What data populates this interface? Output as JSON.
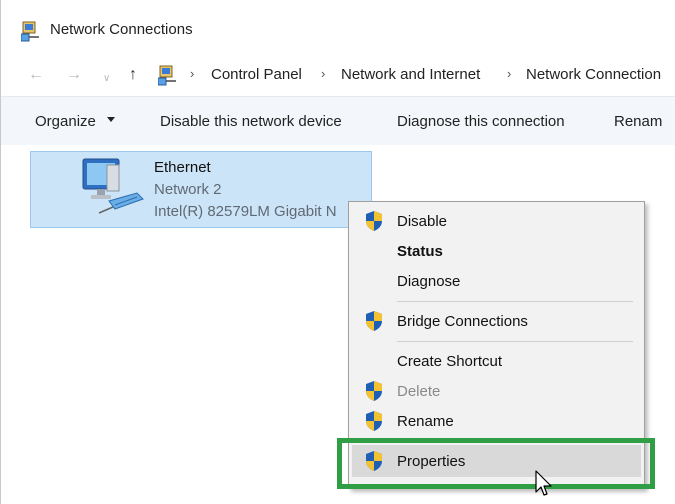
{
  "window": {
    "title": "Network Connections"
  },
  "address": {
    "breadcrumbs": [
      "Control Panel",
      "Network and Internet",
      "Network Connection"
    ]
  },
  "toolbar": {
    "organize": "Organize",
    "disable": "Disable this network device",
    "diagnose": "Diagnose this connection",
    "rename": "Renam"
  },
  "connection": {
    "name": "Ethernet",
    "network": "Network 2",
    "adapter": "Intel(R) 82579LM Gigabit N"
  },
  "context_menu": {
    "items": [
      {
        "label": "Disable",
        "icon": "shield-icon",
        "bold": false,
        "disabled": false
      },
      {
        "label": "Status",
        "icon": null,
        "bold": true,
        "disabled": false
      },
      {
        "label": "Diagnose",
        "icon": null,
        "bold": false,
        "disabled": false
      },
      {
        "label": "Bridge Connections",
        "icon": "shield-icon",
        "bold": false,
        "disabled": false
      },
      {
        "label": "Create Shortcut",
        "icon": null,
        "bold": false,
        "disabled": false
      },
      {
        "label": "Delete",
        "icon": "shield-icon",
        "bold": false,
        "disabled": true
      },
      {
        "label": "Rename",
        "icon": "shield-icon",
        "bold": false,
        "disabled": false
      },
      {
        "label": "Properties",
        "icon": "shield-icon",
        "bold": false,
        "disabled": false,
        "hovered": true
      }
    ],
    "highlight_color": "#2f9e44"
  },
  "colors": {
    "selection_fill": "#cce4f7",
    "selection_border": "#99c9ef",
    "menu_bg": "#f2f2f2",
    "command_bar_bg": "#f3f6fa"
  }
}
